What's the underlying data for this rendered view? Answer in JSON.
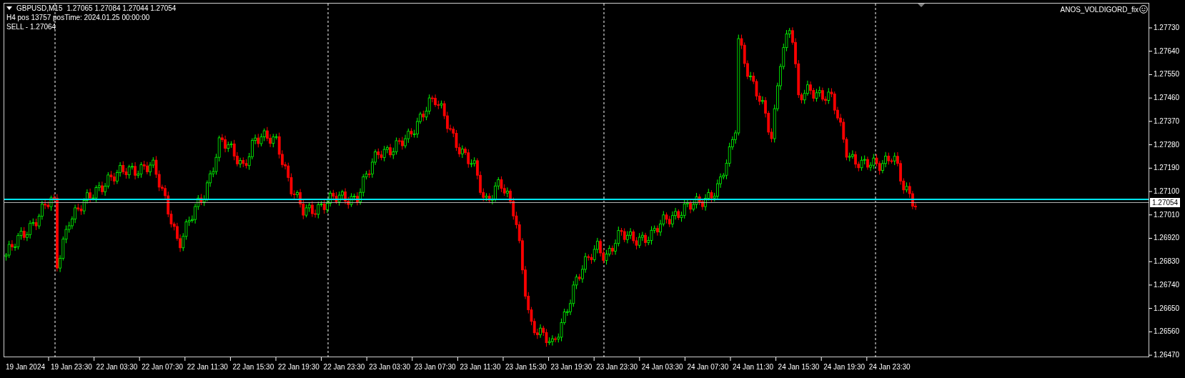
{
  "chart": {
    "header": {
      "symbol": "GBPUSD,M15",
      "ohlc": "1.27065 1.27084 1.27044 1.27054"
    },
    "info_lines": [
      "H4 pos 13757 posTime: 2024.01.25 00:00:00",
      "SELL - 1.27064"
    ],
    "indicator_label": "ANOS_VOLDIGORD_fix",
    "price_labels": [
      "1.27730",
      "1.27640",
      "1.27550",
      "1.27460",
      "1.27370",
      "1.27280",
      "1.27190",
      "1.27100",
      "1.27010",
      "1.26920",
      "1.26830",
      "1.26740",
      "1.26650",
      "1.26560",
      "1.26470"
    ],
    "current_price": "1.27054",
    "time_labels": [
      "19 Jan 2024",
      "19 Jan 23:30",
      "22 Jan 03:30",
      "22 Jan 07:30",
      "22 Jan 11:30",
      "22 Jan 15:30",
      "22 Jan 19:30",
      "22 Jan 23:30",
      "23 Jan 03:30",
      "23 Jan 07:30",
      "23 Jan 11:30",
      "23 Jan 15:30",
      "23 Jan 19:30",
      "23 Jan 23:30",
      "24 Jan 03:30",
      "24 Jan 07:30",
      "24 Jan 11:30",
      "24 Jan 15:30",
      "24 Jan 19:30",
      "24 Jan 23:30"
    ]
  }
}
